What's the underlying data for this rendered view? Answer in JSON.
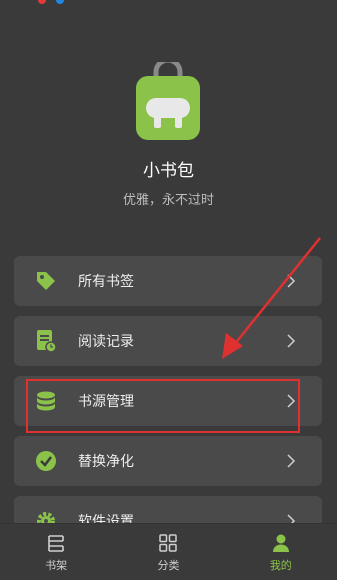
{
  "app": {
    "name": "小书包",
    "slogan": "优雅，永不过时"
  },
  "menu": {
    "items": [
      {
        "label": "所有书签",
        "icon": "tag-icon"
      },
      {
        "label": "阅读记录",
        "icon": "reading-record-icon"
      },
      {
        "label": "书源管理",
        "icon": "database-icon"
      },
      {
        "label": "替换净化",
        "icon": "check-badge-icon"
      },
      {
        "label": "软件设置",
        "icon": "gear-icon"
      }
    ]
  },
  "tabbar": {
    "tabs": [
      {
        "label": "书架",
        "icon": "bookshelf-icon",
        "active": false
      },
      {
        "label": "分类",
        "icon": "grid-icon",
        "active": false
      },
      {
        "label": "我的",
        "icon": "user-icon",
        "active": true
      }
    ]
  },
  "colors": {
    "background": "#3a3a3a",
    "card": "#4a4a4a",
    "accent": "#8bc34a",
    "annotation": "#e03131"
  }
}
